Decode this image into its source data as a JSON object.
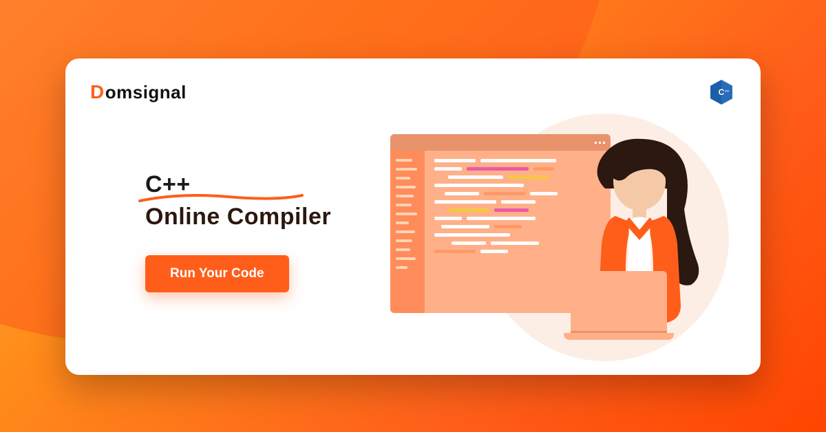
{
  "brand": {
    "name_prefix": "D",
    "name_rest": "omsignal"
  },
  "tech_badge": {
    "label": "C++"
  },
  "hero": {
    "title_line1": "C++",
    "title_line2": "Online Compiler",
    "cta_label": "Run Your Code"
  },
  "colors": {
    "accent": "#ff5e1a",
    "badge": "#1b5faa"
  }
}
